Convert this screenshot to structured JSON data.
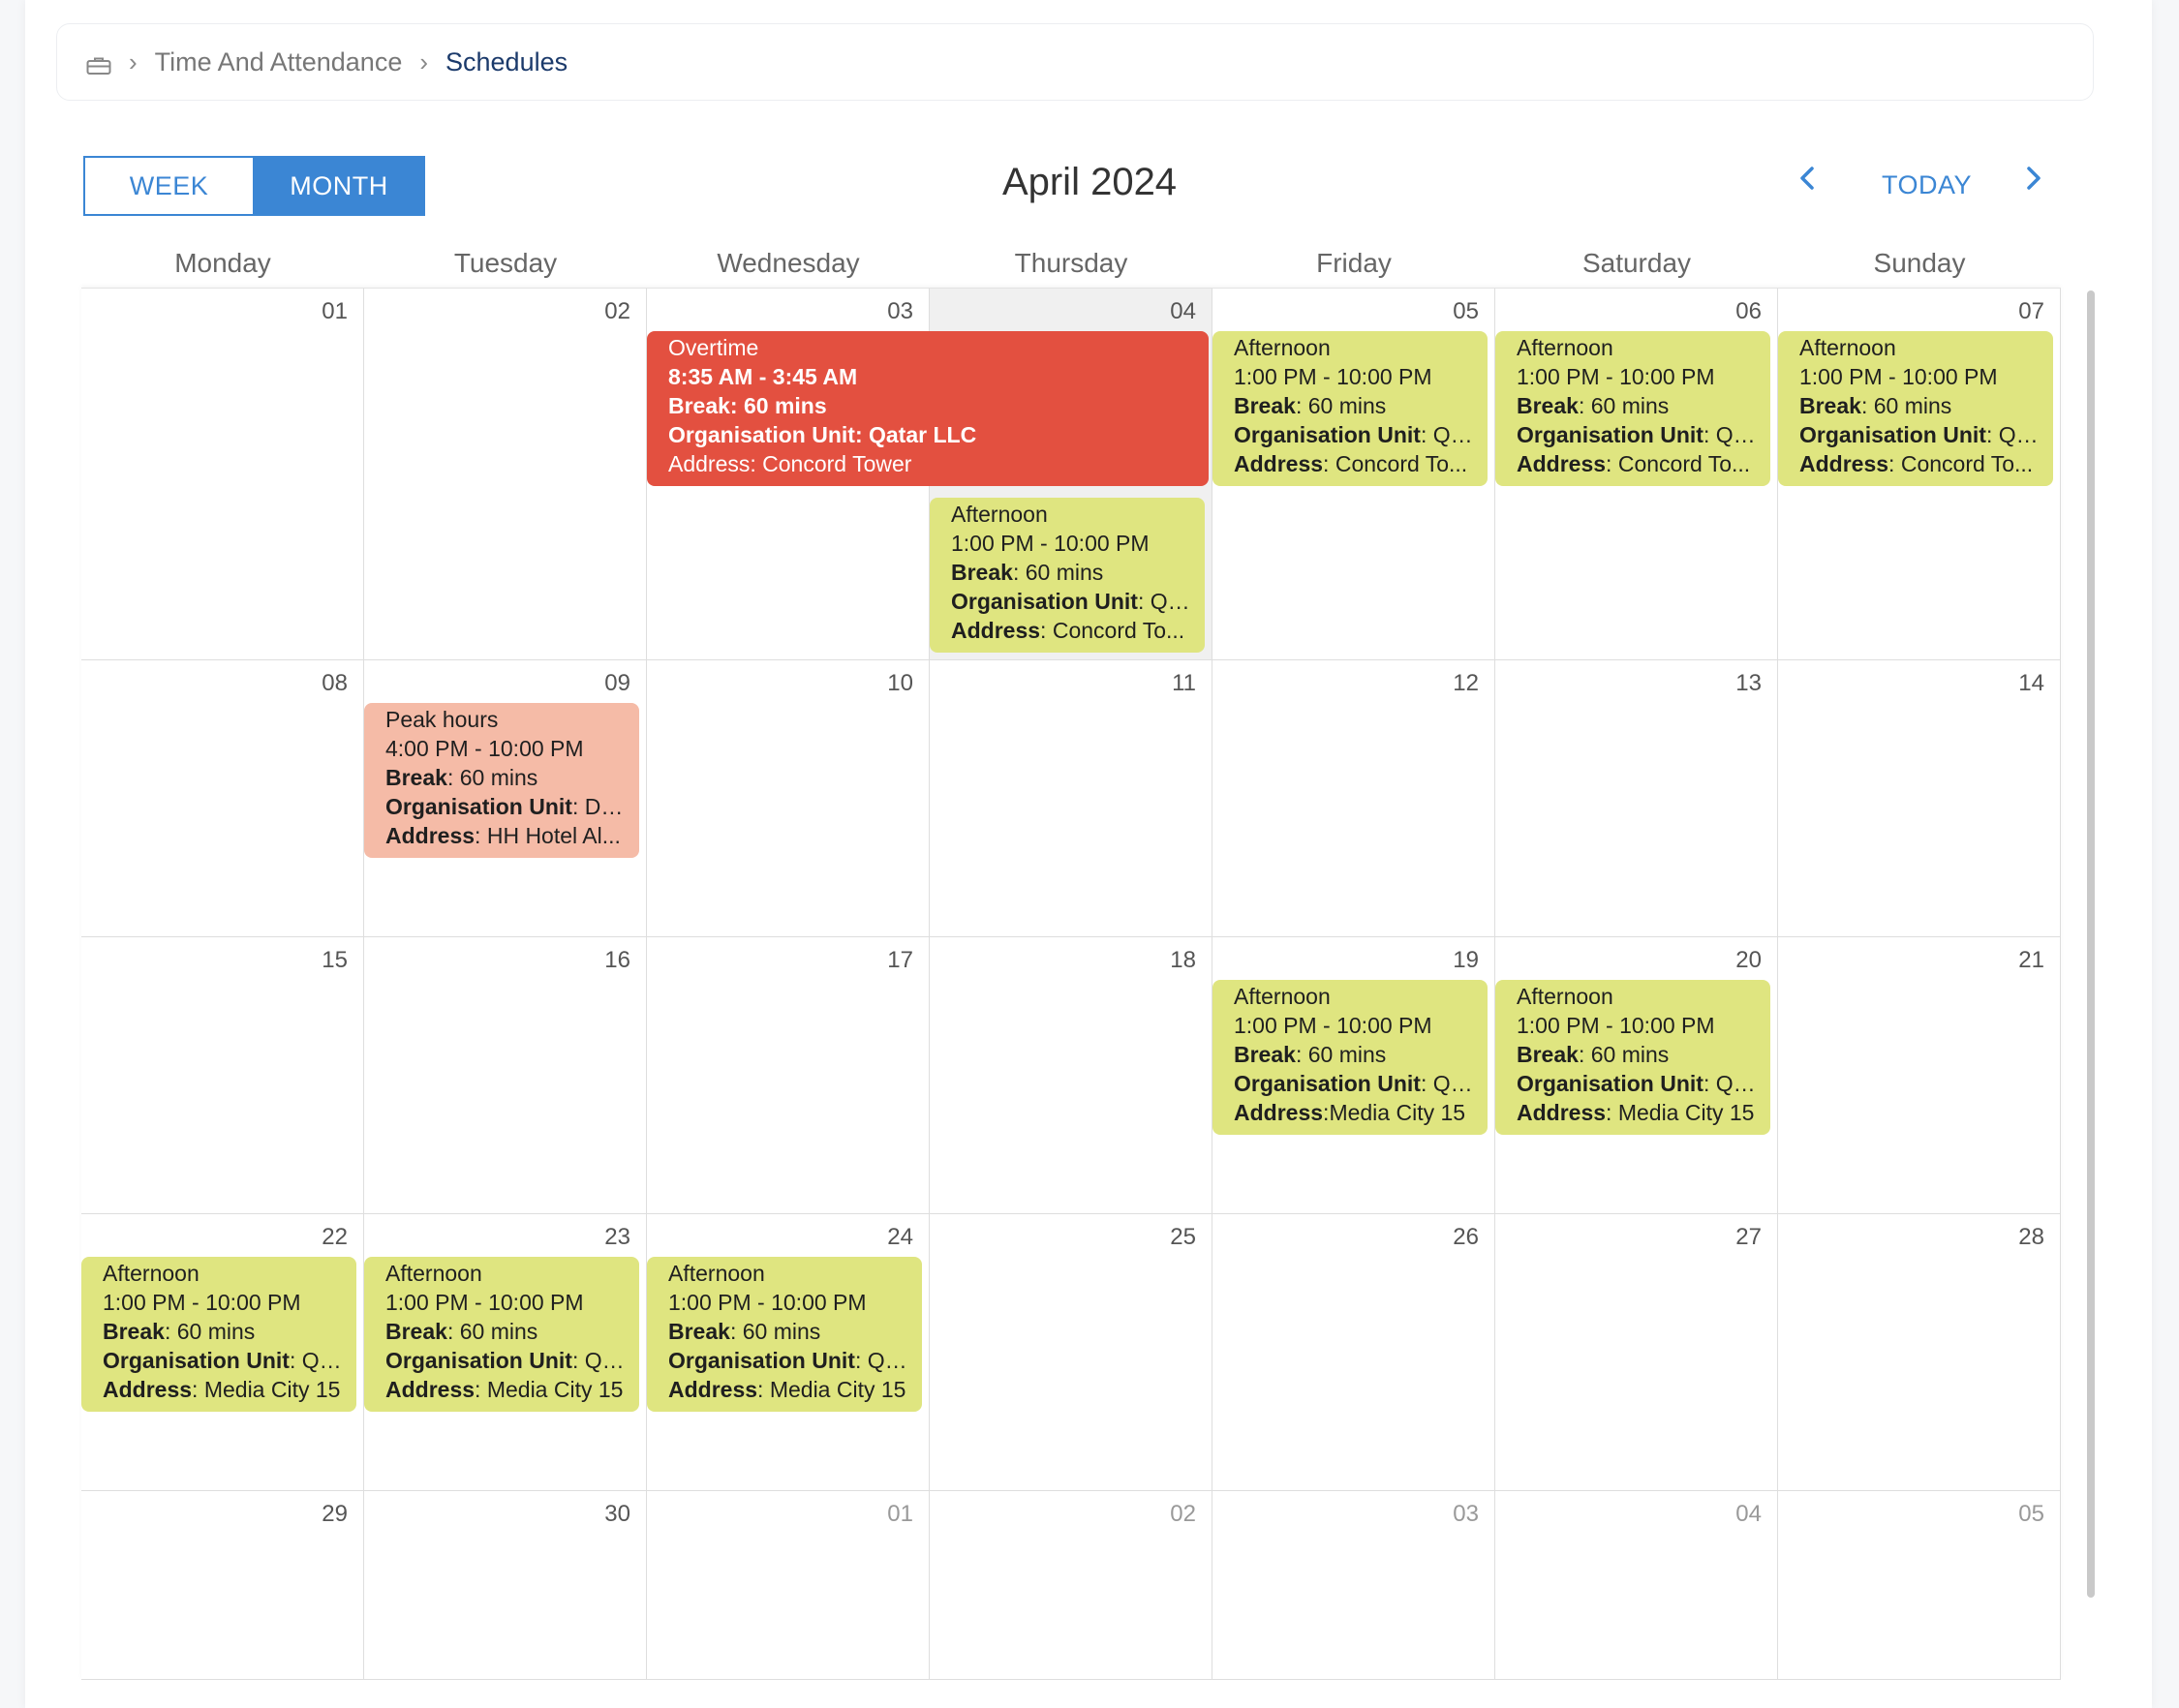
{
  "breadcrumb": {
    "items": [
      "Time And Attendance",
      "Schedules"
    ],
    "home_icon": "briefcase-icon"
  },
  "view_toggle": {
    "week": "WEEK",
    "month": "MONTH",
    "active": "MONTH"
  },
  "calendar_title": "April 2024",
  "nav": {
    "prev_icon": "chevron-left-icon",
    "today": "TODAY",
    "next_icon": "chevron-right-icon"
  },
  "weekdays": [
    "Monday",
    "Tuesday",
    "Wednesday",
    "Thursday",
    "Friday",
    "Saturday",
    "Sunday"
  ],
  "weeks": [
    [
      "01",
      "02",
      "03",
      "04",
      "05",
      "06",
      "07"
    ],
    [
      "08",
      "09",
      "10",
      "11",
      "12",
      "13",
      "14"
    ],
    [
      "15",
      "16",
      "17",
      "18",
      "19",
      "20",
      "21"
    ],
    [
      "22",
      "23",
      "24",
      "25",
      "26",
      "27",
      "28"
    ],
    [
      "29",
      "30",
      "01",
      "02",
      "03",
      "04",
      "05"
    ]
  ],
  "labels": {
    "break": "Break",
    "org_unit": "Organisation Unit",
    "address": "Address"
  },
  "events": {
    "overtime": {
      "title": "Overtime",
      "time": "8:35 AM - 3:45 AM",
      "break": "Break: 60 mins",
      "org": "Organisation Unit: Qatar LLC",
      "address": "Address: Concord Tower"
    },
    "afternoon_0404": {
      "title": "Afternoon",
      "time": "1:00 PM - 10:00 PM",
      "break": "60 mins",
      "org": "Qat...",
      "address": "Concord To..."
    },
    "afternoon_0405": {
      "title": "Afternoon",
      "time": "1:00 PM - 10:00 PM",
      "break": "60 mins",
      "org": "Qat...",
      "address": "Concord To..."
    },
    "afternoon_0406": {
      "title": "Afternoon",
      "time": "1:00 PM - 10:00 PM",
      "break": "60 mins",
      "org": "Qat...",
      "address": "Concord To..."
    },
    "afternoon_0407": {
      "title": "Afternoon",
      "time": "1:00 PM - 10:00 PM",
      "break": "60 mins",
      "org": "Qat...",
      "address": "Concord To..."
    },
    "peak_0409": {
      "title": "Peak hours",
      "time": "4:00 PM - 10:00 PM",
      "break": "60 mins",
      "org": "Don...",
      "address": "HH Hotel Al..."
    },
    "afternoon_0419": {
      "title": "Afternoon",
      "time": "1:00 PM - 10:00 PM",
      "break": "60 mins",
      "org": "Qat...",
      "address": "Media City 15"
    },
    "afternoon_0420": {
      "title": "Afternoon",
      "time": "1:00 PM - 10:00 PM",
      "break": "60 mins",
      "org": "Qat...",
      "address": "Media City 15"
    },
    "afternoon_0422": {
      "title": "Afternoon",
      "time": "1:00 PM - 10:00 PM",
      "break": "60 mins",
      "org": "Qat...",
      "address": "Media City 15"
    },
    "afternoon_0423": {
      "title": "Afternoon",
      "time": "1:00 PM - 10:00 PM",
      "break": "60 mins",
      "org": "Qat...",
      "address": "Media City 15"
    },
    "afternoon_0424": {
      "title": "Afternoon",
      "time": "1:00 PM - 10:00 PM",
      "break": "60 mins",
      "org": "Qat...",
      "address": "Media City 15"
    }
  },
  "colors": {
    "accent": "#3b86d4",
    "shift_green": "#dfe580",
    "overtime_red": "#e35040",
    "peak_peach": "#f5bba7"
  }
}
